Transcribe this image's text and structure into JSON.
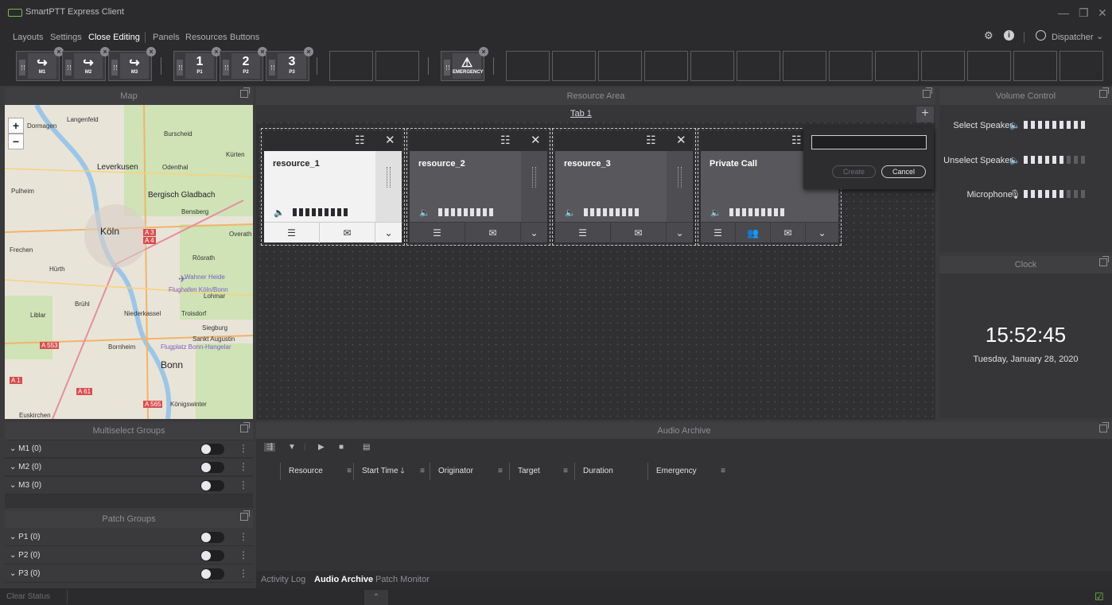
{
  "window": {
    "title": "SmartPTT Express Client",
    "minimize_glyph": "—",
    "restore_glyph": "❐",
    "close_glyph": "✕"
  },
  "menu": {
    "items": [
      "Layouts",
      "Settings",
      "Close Editing",
      "Panels",
      "Resources",
      "Buttons"
    ],
    "user": "Dispatcher"
  },
  "toolbar": {
    "buttons": [
      {
        "glyph": "↪",
        "label": "M1"
      },
      {
        "glyph": "↪",
        "label": "M2"
      },
      {
        "glyph": "↪",
        "label": "M3"
      },
      {
        "glyph": "1",
        "label": "P1"
      },
      {
        "glyph": "2",
        "label": "P2"
      },
      {
        "glyph": "3",
        "label": "P3"
      },
      {
        "glyph": "⚠",
        "label": "EMERGENCY"
      }
    ]
  },
  "panels": {
    "map": "Map",
    "resource_area": "Resource Area",
    "volume_control": "Volume Control",
    "clock": "Clock",
    "multiselect_groups": "Multiselect Groups",
    "patch_groups": "Patch Groups",
    "audio_archive": "Audio Archive"
  },
  "map": {
    "zoom_in": "+",
    "zoom_out": "−",
    "labels": [
      "Dormagen",
      "Langenfeld",
      "Burscheid",
      "Kürten",
      "Leverkusen",
      "Odenthal",
      "Pulheim",
      "Bergisch Gladbach",
      "Bensberg",
      "Köln",
      "Overath",
      "Frechen",
      "Rösrath",
      "Hürth",
      "Wahner Heide",
      "Flughafen Köln/Bonn",
      "Lohmar",
      "Brühl",
      "Liblar",
      "Niederkassel",
      "Troisdorf",
      "Siegburg",
      "Sankt Augustin",
      "A 553",
      "Bornheim",
      "Flugplatz Bonn-Hangelar",
      "Bonn",
      "A 1",
      "A 61",
      "A 565",
      "Königswinter",
      "Euskirchen",
      "A 3",
      "A 4"
    ]
  },
  "resource_area": {
    "tab": "Tab 1",
    "add_tab": "+",
    "resources": [
      {
        "name": "resource_1",
        "selected": true
      },
      {
        "name": "resource_2",
        "selected": false
      },
      {
        "name": "resource_3",
        "selected": false
      },
      {
        "name": "Private Call",
        "selected": false
      }
    ],
    "popup": {
      "input_value": "",
      "create": "Create",
      "cancel": "Cancel"
    }
  },
  "volume": {
    "items": [
      {
        "label": "Select Speaker",
        "level": 9,
        "max": 9
      },
      {
        "label": "Unselect Speaker",
        "level": 6,
        "max": 9
      },
      {
        "label": "Microphone",
        "level": 6,
        "max": 9
      }
    ]
  },
  "clock": {
    "time": "15:52:45",
    "date": "Tuesday, January 28, 2020"
  },
  "multiselect_groups": [
    {
      "label": "M1 (0)"
    },
    {
      "label": "M2 (0)"
    },
    {
      "label": "M3 (0)"
    }
  ],
  "patch_groups": [
    {
      "label": "P1 (0)"
    },
    {
      "label": "P2 (0)"
    },
    {
      "label": "P3 (0)"
    }
  ],
  "audio_archive": {
    "columns": [
      "Resource",
      "Start Time",
      "Originator",
      "Target",
      "Duration",
      "Emergency"
    ]
  },
  "bottom_tabs": [
    "Activity Log",
    "Audio Archive",
    "Patch Monitor"
  ],
  "status": {
    "clear": "Clear Status"
  }
}
